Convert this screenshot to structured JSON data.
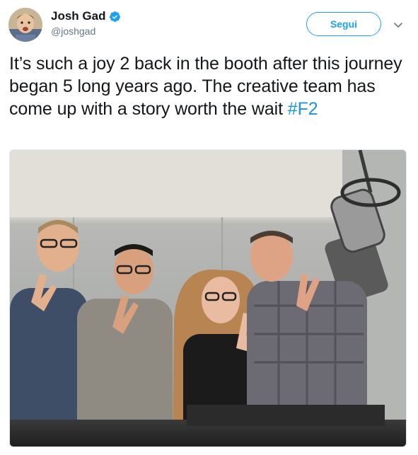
{
  "tweet": {
    "author": {
      "display_name": "Josh Gad",
      "handle": "@joshgad",
      "verified": true,
      "avatar_icon": "avatar-photo"
    },
    "follow_label": "Segui",
    "menu_icon": "chevron-down-icon",
    "text_main": "It’s such a joy 2 back in the booth after this journey began 5 long years ago. The creative team has come up with a story worth the wait ",
    "hashtag": "#F2",
    "media": {
      "type": "photo"
    }
  },
  "colors": {
    "accent": "#1da1f2",
    "hashtag": "#1b95e0",
    "text": "#14171a",
    "muted": "#657786"
  }
}
